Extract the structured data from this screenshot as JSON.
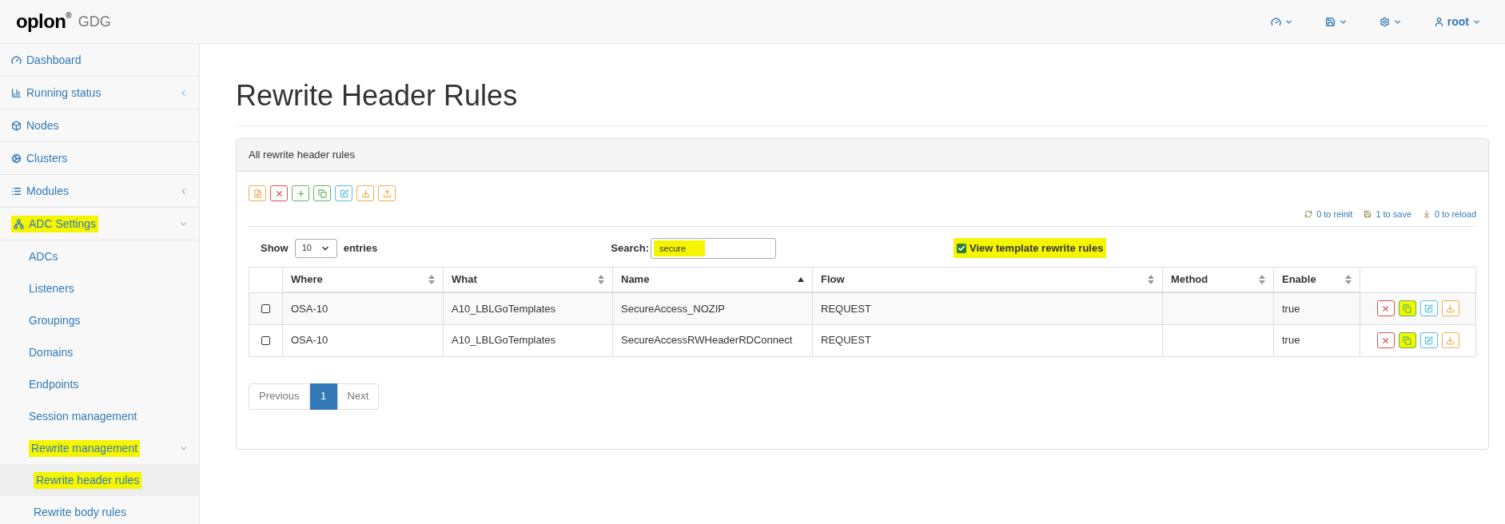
{
  "brand": {
    "name": "oplon",
    "mark": "®",
    "product": "GDG"
  },
  "topnav": [
    {
      "kind": "dashboard"
    },
    {
      "kind": "save"
    },
    {
      "kind": "settings"
    },
    {
      "kind": "user",
      "label": "root"
    }
  ],
  "sidebar": {
    "items": [
      {
        "label": "Dashboard",
        "highlighted": false
      },
      {
        "label": "Running status",
        "expanded": false,
        "highlighted": false
      },
      {
        "label": "Nodes",
        "highlighted": false
      },
      {
        "label": "Clusters",
        "highlighted": false
      },
      {
        "label": "Modules",
        "expanded": false,
        "highlighted": false
      },
      {
        "label": "ADC Settings",
        "expanded": true,
        "highlighted": true,
        "children": [
          {
            "label": "ADCs",
            "highlighted": false
          },
          {
            "label": "Listeners",
            "highlighted": false
          },
          {
            "label": "Groupings",
            "highlighted": false
          },
          {
            "label": "Domains",
            "highlighted": false
          },
          {
            "label": "Endpoints",
            "highlighted": false
          },
          {
            "label": "Session management",
            "highlighted": false
          },
          {
            "label": "Rewrite management",
            "expanded": true,
            "highlighted": true,
            "children": [
              {
                "label": "Rewrite header rules",
                "selected": true,
                "highlighted": true
              },
              {
                "label": "Rewrite body rules",
                "selected": false,
                "highlighted": false
              }
            ]
          }
        ]
      }
    ]
  },
  "page_title": "Rewrite Header Rules",
  "panel": {
    "title": "All rewrite header rules",
    "toolbar": [
      {
        "kind": "export"
      },
      {
        "kind": "delete"
      },
      {
        "kind": "add"
      },
      {
        "kind": "clone"
      },
      {
        "kind": "edit"
      },
      {
        "kind": "download"
      },
      {
        "kind": "upload"
      }
    ],
    "status": [
      {
        "kind": "reinit",
        "label": "0 to reinit"
      },
      {
        "kind": "save",
        "label": "1 to save"
      },
      {
        "kind": "reload",
        "label": "0 to reload"
      }
    ],
    "length": {
      "before": "Show",
      "value": "10",
      "after": "entries"
    },
    "search": {
      "label": "Search:",
      "value": "secure",
      "highlighted": true
    },
    "view_template": {
      "label": "View template rewrite rules",
      "checked": true,
      "highlighted": true
    },
    "table": {
      "columns": [
        {
          "label": "Where",
          "sorted_ascending": false
        },
        {
          "label": "What",
          "sorted_ascending": false
        },
        {
          "label": "Name",
          "sorted_ascending": true
        },
        {
          "label": "Flow",
          "sorted_ascending": false
        },
        {
          "label": "Method",
          "sorted_ascending": false
        },
        {
          "label": "Enable",
          "sorted_ascending": false
        }
      ],
      "rows": [
        {
          "checked": false,
          "cells": [
            "OSA-10",
            "A10_LBLGoTemplates",
            "SecureAccess_NOZIP",
            "REQUEST",
            "",
            "true"
          ],
          "actions": [
            {
              "kind": "delete",
              "highlighted": false
            },
            {
              "kind": "clone",
              "highlighted": true
            },
            {
              "kind": "edit",
              "highlighted": false
            },
            {
              "kind": "download",
              "highlighted": false
            }
          ]
        },
        {
          "checked": false,
          "cells": [
            "OSA-10",
            "A10_LBLGoTemplates",
            "SecureAccessRWHeaderRDConnect",
            "REQUEST",
            "",
            "true"
          ],
          "actions": [
            {
              "kind": "delete",
              "highlighted": false
            },
            {
              "kind": "clone",
              "highlighted": true
            },
            {
              "kind": "edit",
              "highlighted": false
            },
            {
              "kind": "download",
              "highlighted": false
            }
          ]
        }
      ]
    },
    "pagination": {
      "previous": "Previous",
      "next": "Next",
      "pages": [
        {
          "label": "1",
          "selected": true
        }
      ]
    }
  }
}
